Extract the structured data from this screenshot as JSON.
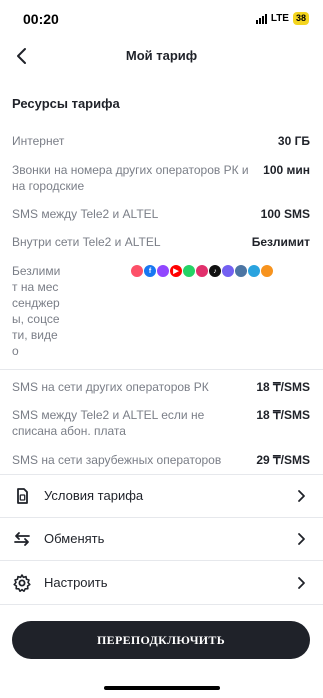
{
  "status": {
    "time": "00:20",
    "network": "LTE",
    "battery": "38"
  },
  "header": {
    "title": "Мой тариф"
  },
  "section": {
    "title": "Ресурсы тарифа"
  },
  "resources": [
    {
      "label": "Интернет",
      "value": "30 ГБ"
    },
    {
      "label": "Звонки на номера других операторов РК и на городские",
      "value": "100 мин"
    },
    {
      "label": "SMS между Tele2 и ALTEL",
      "value": "100 SMS"
    },
    {
      "label": "Внутри сети Tele2 и ALTEL",
      "value": "Безлимит"
    },
    {
      "label": "Безлимит на мессенджеры, соцсети, видео"
    }
  ],
  "messenger_apps": [
    {
      "name": "tinder",
      "color": "#fd5068"
    },
    {
      "name": "facebook",
      "color": "#1877f2"
    },
    {
      "name": "twitch",
      "color": "#9146ff"
    },
    {
      "name": "youtube",
      "color": "#ff0000"
    },
    {
      "name": "whatsapp",
      "color": "#25d366"
    },
    {
      "name": "instagram",
      "color": "#e1306c"
    },
    {
      "name": "tiktok",
      "color": "#111111"
    },
    {
      "name": "viber",
      "color": "#7360f2"
    },
    {
      "name": "vk",
      "color": "#4c75a3"
    },
    {
      "name": "telegram",
      "color": "#2aa3df"
    },
    {
      "name": "odnoklassniki",
      "color": "#f7931e"
    }
  ],
  "sms_rates": [
    {
      "label": "SMS на сети других операторов РК",
      "value": "18 ₸/SMS"
    },
    {
      "label": "SMS между Tele2 и ALTEL если не списана абон. плата",
      "value": "18 ₸/SMS"
    },
    {
      "label": "SMS на сети зарубежных операторов",
      "value": "29 ₸/SMS"
    }
  ],
  "menu": [
    {
      "label": "Условия тарифа",
      "icon": "sim-card-icon"
    },
    {
      "label": "Обменять",
      "icon": "exchange-arrows-icon"
    },
    {
      "label": "Настроить",
      "icon": "gear-icon"
    }
  ],
  "cta": {
    "label": "ПЕРЕПОДКЛЮЧИТЬ"
  }
}
